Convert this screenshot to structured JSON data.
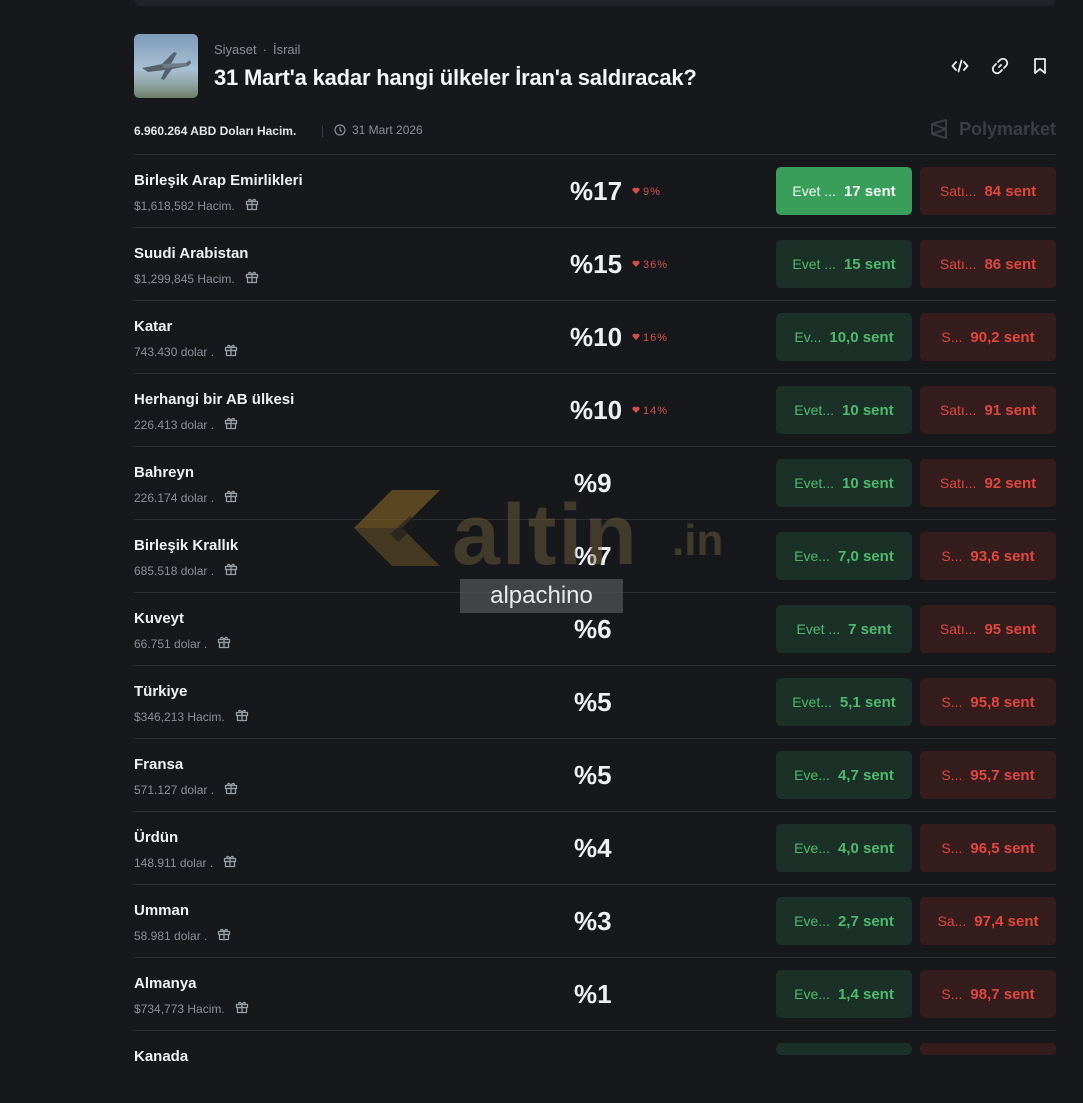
{
  "header": {
    "category": "Siyaset",
    "separator": "·",
    "tag": "İsrail",
    "title": "31 Mart'a kadar hangi ülkeler İran'a saldıracak?"
  },
  "meta": {
    "volume": "6.960.264 ABD Doları Hacim.",
    "date": "31 Mart 2026",
    "brand": "Polymarket"
  },
  "watermark": {
    "site": "altin",
    "tld": ".in",
    "user": "alpachino"
  },
  "rows": [
    {
      "name": "Birleşik Arap Emirlikleri",
      "volume": "$1,618,582 Hacim.",
      "pct": "%17",
      "change": "9%",
      "yes_label": "Evet ...",
      "yes_price": "17 sent",
      "no_label": "Satı...",
      "no_price": "84 sent"
    },
    {
      "name": "Suudi Arabistan",
      "volume": "$1,299,845 Hacim.",
      "pct": "%15",
      "change": "36%",
      "yes_label": "Evet ...",
      "yes_price": "15 sent",
      "no_label": "Satı...",
      "no_price": "86 sent"
    },
    {
      "name": "Katar",
      "volume": "743.430 dolar .",
      "pct": "%10",
      "change": "16%",
      "yes_label": "Ev...",
      "yes_price": "10,0 sent",
      "no_label": "S...",
      "no_price": "90,2 sent"
    },
    {
      "name": "Herhangi bir AB ülkesi",
      "volume": "226.413 dolar .",
      "pct": "%10",
      "change": "14%",
      "yes_label": "Evet...",
      "yes_price": "10 sent",
      "no_label": "Satı...",
      "no_price": "91 sent"
    },
    {
      "name": "Bahreyn",
      "volume": "226.174 dolar .",
      "pct": "%9",
      "change": "",
      "yes_label": "Evet...",
      "yes_price": "10 sent",
      "no_label": "Satı...",
      "no_price": "92 sent"
    },
    {
      "name": "Birleşik Krallık",
      "volume": "685.518 dolar .",
      "pct": "%7",
      "change": "",
      "yes_label": "Eve...",
      "yes_price": "7,0 sent",
      "no_label": "S...",
      "no_price": "93,6 sent"
    },
    {
      "name": "Kuveyt",
      "volume": "66.751 dolar .",
      "pct": "%6",
      "change": "",
      "yes_label": "Evet ...",
      "yes_price": "7 sent",
      "no_label": "Satı...",
      "no_price": "95 sent"
    },
    {
      "name": "Türkiye",
      "volume": "$346,213 Hacim.",
      "pct": "%5",
      "change": "",
      "yes_label": "Evet...",
      "yes_price": "5,1 sent",
      "no_label": "S...",
      "no_price": "95,8 sent"
    },
    {
      "name": "Fransa",
      "volume": "571.127 dolar .",
      "pct": "%5",
      "change": "",
      "yes_label": "Eve...",
      "yes_price": "4,7 sent",
      "no_label": "S...",
      "no_price": "95,7 sent"
    },
    {
      "name": "Ürdün",
      "volume": "148.911 dolar .",
      "pct": "%4",
      "change": "",
      "yes_label": "Eve...",
      "yes_price": "4,0 sent",
      "no_label": "S...",
      "no_price": "96,5 sent"
    },
    {
      "name": "Umman",
      "volume": "58.981 dolar .",
      "pct": "%3",
      "change": "",
      "yes_label": "Eve...",
      "yes_price": "2,7 sent",
      "no_label": "Sa...",
      "no_price": "97,4 sent"
    },
    {
      "name": "Almanya",
      "volume": "$734,773 Hacim.",
      "pct": "%1",
      "change": "",
      "yes_label": "Eve...",
      "yes_price": "1,4 sent",
      "no_label": "S...",
      "no_price": "98,7 sent"
    },
    {
      "name": "Kanada",
      "volume": "",
      "pct": "",
      "change": "",
      "yes_label": "",
      "yes_price": "",
      "no_label": "",
      "no_price": ""
    }
  ],
  "icons": {
    "embed": "code-icon",
    "link": "link-icon",
    "bookmark": "bookmark-icon",
    "clock": "clock-icon",
    "gift": "gift-icon",
    "down": "heart-down-icon"
  },
  "colors": {
    "background": "#16181c",
    "yes_bg": "#1b3026",
    "yes_active": "#3a9e5b",
    "yes_text": "#4fba6f",
    "no_bg": "#351c1d",
    "no_text": "#e0473f"
  }
}
